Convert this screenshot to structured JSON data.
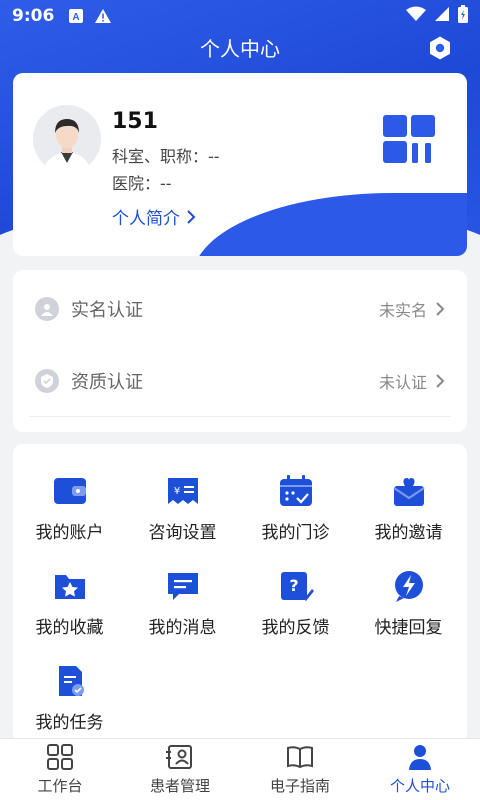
{
  "status_bar": {
    "time": "9:06"
  },
  "header": {
    "title": "个人中心"
  },
  "profile": {
    "name": "151",
    "dept_title": "科室、职称：--",
    "hospital": "医院：--",
    "intro_link": "个人简介"
  },
  "certifications": [
    {
      "label": "实名认证",
      "value": "未实名",
      "icon": "user-icon"
    },
    {
      "label": "资质认证",
      "value": "未认证",
      "icon": "badge-icon"
    }
  ],
  "grid_items": [
    {
      "label": "我的账户",
      "icon": "wallet-icon"
    },
    {
      "label": "咨询设置",
      "icon": "consult-settings-icon"
    },
    {
      "label": "我的门诊",
      "icon": "calendar-icon"
    },
    {
      "label": "我的邀请",
      "icon": "invite-envelope-icon"
    },
    {
      "label": "我的收藏",
      "icon": "star-folder-icon"
    },
    {
      "label": "我的消息",
      "icon": "message-icon"
    },
    {
      "label": "我的反馈",
      "icon": "feedback-icon"
    },
    {
      "label": "快捷回复",
      "icon": "lightning-chat-icon"
    },
    {
      "label": "我的任务",
      "icon": "task-icon"
    }
  ],
  "tabs": [
    {
      "label": "工作台",
      "icon": "grid-icon",
      "active": false
    },
    {
      "label": "患者管理",
      "icon": "patient-card-icon",
      "active": false
    },
    {
      "label": "电子指南",
      "icon": "book-icon",
      "active": false
    },
    {
      "label": "个人中心",
      "icon": "person-icon",
      "active": true
    }
  ],
  "colors": {
    "primary": "#1e4fd8",
    "header_bg": "#2c59e8",
    "icon_blue": "#1e4fd8"
  }
}
